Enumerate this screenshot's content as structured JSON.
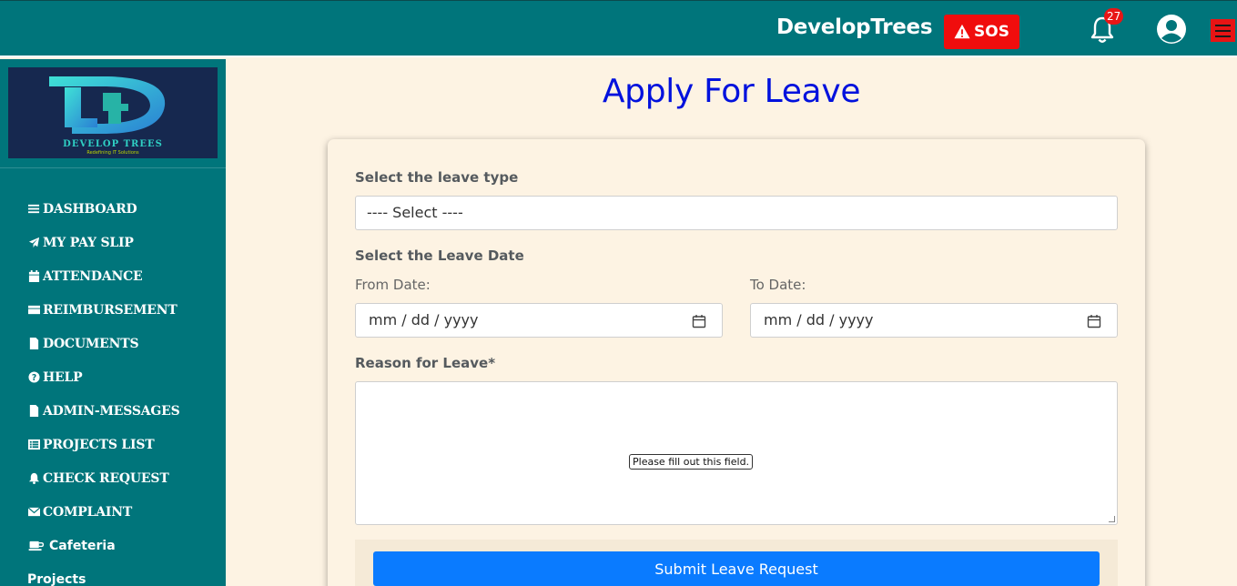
{
  "header": {
    "brand": "DevelopTrees",
    "sos_label": "SOS",
    "notification_count": "27"
  },
  "logo": {
    "name": "DEVELOP TREES",
    "tagline": "Redefining IT Solutions"
  },
  "sidebar": {
    "items": [
      {
        "label": "DASHBOARD",
        "icon": "list-icon"
      },
      {
        "label": "MY PAY SLIP",
        "icon": "paper-plane-icon"
      },
      {
        "label": "ATTENDANCE",
        "icon": "calendar-icon"
      },
      {
        "label": "REIMBURSEMENT",
        "icon": "credit-card-icon"
      },
      {
        "label": "DOCUMENTS",
        "icon": "file-icon"
      },
      {
        "label": "HELP",
        "icon": "question-circle-icon"
      },
      {
        "label": "ADMIN-MESSAGES",
        "icon": "file-icon"
      },
      {
        "label": "PROJECTS LIST",
        "icon": "list-alt-icon"
      },
      {
        "label": "CHECK REQUEST",
        "icon": "bell-icon"
      },
      {
        "label": "COMPLAINT",
        "icon": "envelope-icon"
      },
      {
        "label": "Cafeteria",
        "icon": "coffee-icon"
      },
      {
        "label": "Projects",
        "icon": ""
      }
    ]
  },
  "page": {
    "title": "Apply For Leave"
  },
  "form": {
    "leave_type_label": "Select the leave type",
    "leave_type_value": "---- Select ----",
    "leave_date_label": "Select the Leave Date",
    "from_label": "From Date:",
    "from_placeholder": "mm / dd / yyyy",
    "to_label": "To Date:",
    "to_placeholder": "mm / dd / yyyy",
    "reason_label": "Reason for Leave*",
    "validation_tooltip": "Please fill out this field.",
    "submit_label": "Submit Leave Request"
  },
  "colors": {
    "header_bg": "#00757b",
    "sos_bg": "#f00d0d",
    "title": "#0011dd",
    "submit_bg": "#0a7bff",
    "page_bg": "#fdf3e3"
  }
}
